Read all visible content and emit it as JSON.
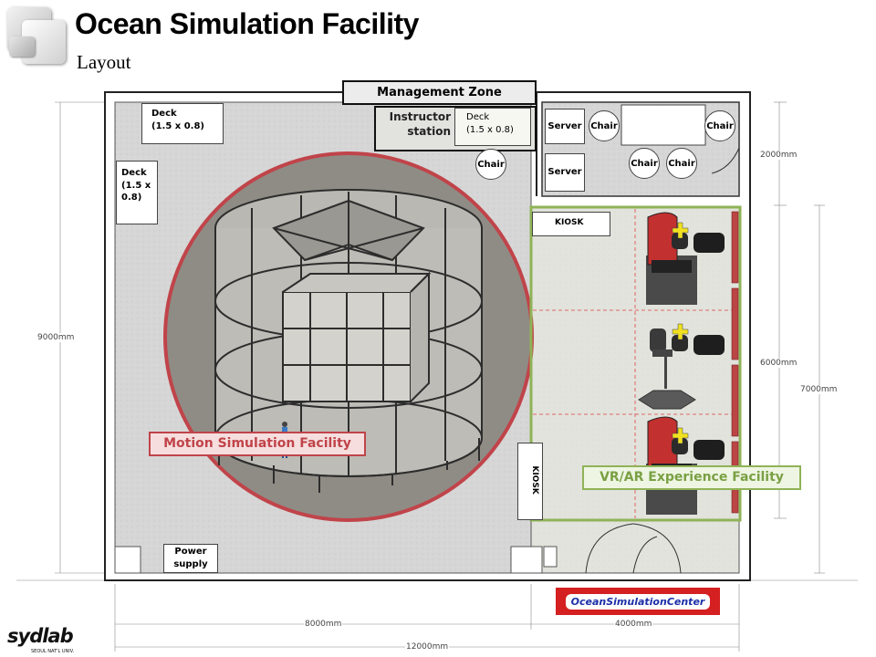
{
  "header": {
    "title": "Ocean Simulation Facility",
    "subtitle": "Layout"
  },
  "zones": {
    "management": "Management Zone",
    "motion": "Motion Simulation Facility",
    "vrar": "VR/AR Experience Facility"
  },
  "equipment": {
    "instructor_station": "Instructor\nstation",
    "deck_top_left": "Deck\n(1.5 x 0.8)",
    "deck_left": "Deck\n(1.5 x\n0.8)",
    "deck_instructor": "Deck\n(1.5 x 0.8)",
    "power_supply": "Power\nsupply",
    "server_1": "Server",
    "server_2": "Server",
    "kiosk_top": "KIOSK",
    "kiosk_side": "KIOSK",
    "chair_label": "Chair"
  },
  "dimensions": {
    "d2000": "2000mm",
    "d6000": "6000mm",
    "d7000": "7000mm",
    "d9000": "9000mm",
    "d8000": "8000mm",
    "d4000": "4000mm",
    "d12000": "12000mm"
  },
  "branding": {
    "osc_logo": "OceanSimulationCenter",
    "sydlab": "sydlab",
    "sydlab_sub": "SEOUL NAT'L UNIV."
  }
}
